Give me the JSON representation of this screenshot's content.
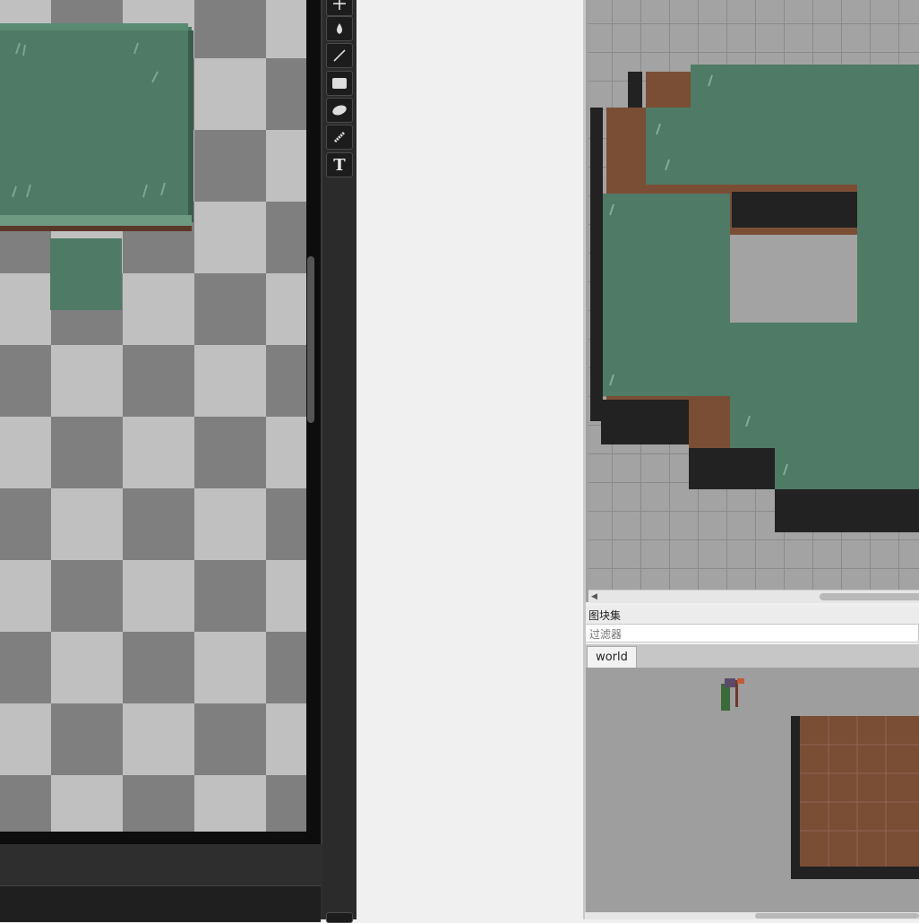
{
  "editor": {
    "tools": [
      {
        "icon": "move-icon"
      },
      {
        "icon": "fill-icon"
      },
      {
        "icon": "line-icon"
      },
      {
        "icon": "rectangle-icon"
      },
      {
        "icon": "ellipse-icon"
      },
      {
        "icon": "spray-icon"
      },
      {
        "icon": "text-icon",
        "glyph": "T"
      }
    ]
  },
  "map": {
    "colors": {
      "grass": "#4f7a66",
      "dirt": "#7a4e35",
      "rock": "#1e1e1e",
      "empty": "#a3a3a3"
    }
  },
  "tileset_panel": {
    "title": "图块集",
    "filter_placeholder": "过滤器",
    "tabs": [
      {
        "label": "world"
      }
    ]
  }
}
